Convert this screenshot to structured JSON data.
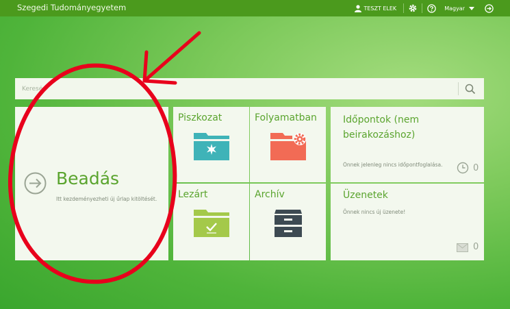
{
  "header": {
    "brand": "Szegedi Tudományegyetem",
    "user_name": "TESZT ELEK",
    "language": "Magyar",
    "icons": [
      "user-icon",
      "gear-icon",
      "help-icon",
      "chevron-down-icon",
      "logout-icon"
    ]
  },
  "search": {
    "placeholder": "Keresés",
    "icon": "search-icon"
  },
  "tiles": {
    "beadas": {
      "title": "Beadás",
      "subtitle": "Itt kezdeményezheti új űrlap kitöltését.",
      "icon": "arrow-right-circle-icon"
    },
    "piszkozat": {
      "title": "Piszkozat",
      "icon": "folder-draft-icon",
      "color": "#3fb3b8"
    },
    "folyamatban": {
      "title": "Folyamatban",
      "icon": "folder-gear-icon",
      "color": "#f26b55"
    },
    "lezart": {
      "title": "Lezárt",
      "icon": "folder-check-icon",
      "color": "#a4c94a"
    },
    "archiv": {
      "title": "Archív",
      "icon": "archive-cabinet-icon",
      "color": "#3d4a52"
    },
    "idopontok": {
      "title": "Időpontok (nem beirakozáshoz)",
      "subtitle": "Önnek jelenleg nincs időpontfoglalása.",
      "count": "0",
      "icon": "clock-icon"
    },
    "uzenetek": {
      "title": "Üzenetek",
      "subtitle": "Önnek nincs új üzenete!",
      "count": "0",
      "icon": "envelope-icon"
    }
  },
  "colors": {
    "topbar": "#4b9a1d",
    "accent": "#5aa42e",
    "annotation": "#e8001c"
  }
}
